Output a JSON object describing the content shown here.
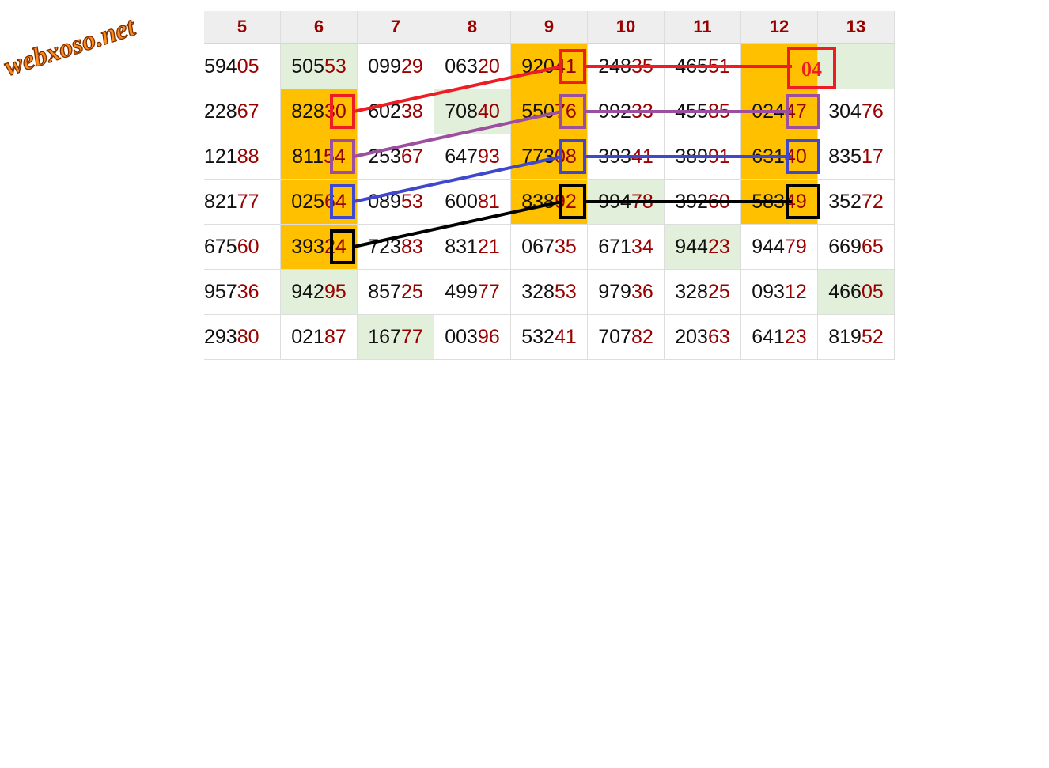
{
  "brand": {
    "logo_text": "webxoso.net"
  },
  "table": {
    "columns": [
      "5",
      "6",
      "7",
      "8",
      "9",
      "10",
      "11",
      "12",
      "13"
    ],
    "rows": [
      [
        {
          "head": "594",
          "tail": "05",
          "bg": ""
        },
        {
          "head": "505",
          "tail": "53",
          "bg": "green"
        },
        {
          "head": "099",
          "tail": "29",
          "bg": ""
        },
        {
          "head": "063",
          "tail": "20",
          "bg": ""
        },
        {
          "head": "920",
          "tail": "41",
          "bg": "gold"
        },
        {
          "head": "248",
          "tail": "35",
          "bg": ""
        },
        {
          "head": "465",
          "tail": "51",
          "bg": ""
        },
        {
          "head": "",
          "tail": "",
          "bg": "gold"
        },
        {
          "head": "",
          "tail": "",
          "bg": "green"
        }
      ],
      [
        {
          "head": "228",
          "tail": "67",
          "bg": ""
        },
        {
          "head": "828",
          "tail": "30",
          "bg": "gold"
        },
        {
          "head": "602",
          "tail": "38",
          "bg": ""
        },
        {
          "head": "708",
          "tail": "40",
          "bg": "green"
        },
        {
          "head": "550",
          "tail": "76",
          "bg": "gold"
        },
        {
          "head": "992",
          "tail": "33",
          "bg": ""
        },
        {
          "head": "455",
          "tail": "85",
          "bg": ""
        },
        {
          "head": "024",
          "tail": "47",
          "bg": "gold"
        },
        {
          "head": "304",
          "tail": "76",
          "bg": ""
        }
      ],
      [
        {
          "head": "121",
          "tail": "88",
          "bg": ""
        },
        {
          "head": "811",
          "tail": "54",
          "bg": "gold"
        },
        {
          "head": "253",
          "tail": "67",
          "bg": ""
        },
        {
          "head": "647",
          "tail": "93",
          "bg": ""
        },
        {
          "head": "773",
          "tail": "08",
          "bg": "gold"
        },
        {
          "head": "393",
          "tail": "41",
          "bg": ""
        },
        {
          "head": "389",
          "tail": "91",
          "bg": ""
        },
        {
          "head": "631",
          "tail": "40",
          "bg": "gold"
        },
        {
          "head": "835",
          "tail": "17",
          "bg": ""
        }
      ],
      [
        {
          "head": "821",
          "tail": "77",
          "bg": ""
        },
        {
          "head": "025",
          "tail": "64",
          "bg": "gold"
        },
        {
          "head": "089",
          "tail": "53",
          "bg": ""
        },
        {
          "head": "600",
          "tail": "81",
          "bg": ""
        },
        {
          "head": "838",
          "tail": "92",
          "bg": "gold"
        },
        {
          "head": "994",
          "tail": "78",
          "bg": "green"
        },
        {
          "head": "392",
          "tail": "60",
          "bg": ""
        },
        {
          "head": "583",
          "tail": "49",
          "bg": "gold"
        },
        {
          "head": "352",
          "tail": "72",
          "bg": ""
        }
      ],
      [
        {
          "head": "675",
          "tail": "60",
          "bg": ""
        },
        {
          "head": "393",
          "tail": "24",
          "bg": "gold"
        },
        {
          "head": "723",
          "tail": "83",
          "bg": ""
        },
        {
          "head": "831",
          "tail": "21",
          "bg": ""
        },
        {
          "head": "067",
          "tail": "35",
          "bg": ""
        },
        {
          "head": "671",
          "tail": "34",
          "bg": ""
        },
        {
          "head": "944",
          "tail": "23",
          "bg": "green"
        },
        {
          "head": "944",
          "tail": "79",
          "bg": ""
        },
        {
          "head": "669",
          "tail": "65",
          "bg": ""
        }
      ],
      [
        {
          "head": "957",
          "tail": "36",
          "bg": ""
        },
        {
          "head": "942",
          "tail": "95",
          "bg": "green"
        },
        {
          "head": "857",
          "tail": "25",
          "bg": ""
        },
        {
          "head": "499",
          "tail": "77",
          "bg": ""
        },
        {
          "head": "328",
          "tail": "53",
          "bg": ""
        },
        {
          "head": "979",
          "tail": "36",
          "bg": ""
        },
        {
          "head": "328",
          "tail": "25",
          "bg": ""
        },
        {
          "head": "093",
          "tail": "12",
          "bg": ""
        },
        {
          "head": "466",
          "tail": "05",
          "bg": "green"
        }
      ],
      [
        {
          "head": "293",
          "tail": "80",
          "bg": ""
        },
        {
          "head": "021",
          "tail": "87",
          "bg": ""
        },
        {
          "head": "167",
          "tail": "77",
          "bg": "green"
        },
        {
          "head": "003",
          "tail": "96",
          "bg": ""
        },
        {
          "head": "532",
          "tail": "41",
          "bg": ""
        },
        {
          "head": "707",
          "tail": "82",
          "bg": ""
        },
        {
          "head": "203",
          "tail": "63",
          "bg": ""
        },
        {
          "head": "641",
          "tail": "23",
          "bg": ""
        },
        {
          "head": "819",
          "tail": "52",
          "bg": ""
        }
      ]
    ]
  },
  "prediction": {
    "value": "04"
  },
  "colors": {
    "tail_red": "#990000",
    "gold": "#ffc000",
    "green": "#e2efda"
  },
  "paths": [
    {
      "color": "#ee1c24",
      "cells": [
        [
          1,
          1
        ],
        [
          0,
          4
        ],
        [
          0,
          7
        ]
      ]
    },
    {
      "color": "#9b4f9e",
      "cells": [
        [
          2,
          1
        ],
        [
          1,
          4
        ],
        [
          1,
          7
        ]
      ]
    },
    {
      "color": "#3f48cc",
      "cells": [
        [
          3,
          1
        ],
        [
          2,
          4
        ],
        [
          2,
          7
        ]
      ]
    },
    {
      "color": "#000000",
      "cells": [
        [
          4,
          1
        ],
        [
          3,
          4
        ],
        [
          3,
          7
        ]
      ]
    }
  ]
}
